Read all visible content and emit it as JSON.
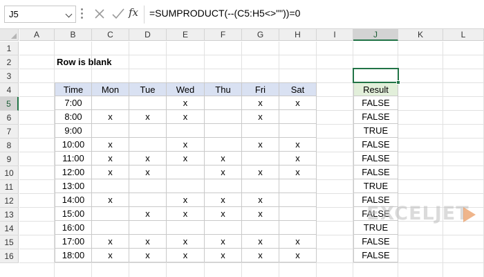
{
  "formula_bar": {
    "name_box": "J5",
    "fx_label": "fx",
    "formula": "=SUMPRODUCT(--(C5:H5<>\"\"))=0"
  },
  "columns": [
    "A",
    "B",
    "C",
    "D",
    "E",
    "F",
    "G",
    "H",
    "I",
    "J",
    "K",
    "L"
  ],
  "rows": [
    "1",
    "2",
    "3",
    "4",
    "5",
    "6",
    "7",
    "8",
    "9",
    "10",
    "11",
    "12",
    "13",
    "14",
    "15",
    "16"
  ],
  "sheet": {
    "title": "Row is blank",
    "headers": [
      "Time",
      "Mon",
      "Tue",
      "Wed",
      "Thu",
      "Fri",
      "Sat"
    ],
    "result_header": "Result",
    "data": [
      [
        "7:00",
        "",
        "",
        "x",
        "",
        "x",
        "x"
      ],
      [
        "8:00",
        "x",
        "x",
        "x",
        "",
        "x",
        ""
      ],
      [
        "9:00",
        "",
        "",
        "",
        "",
        "",
        ""
      ],
      [
        "10:00",
        "x",
        "",
        "x",
        "",
        "x",
        "x"
      ],
      [
        "11:00",
        "x",
        "x",
        "x",
        "x",
        "",
        "x"
      ],
      [
        "12:00",
        "x",
        "x",
        "",
        "x",
        "x",
        "x"
      ],
      [
        "13:00",
        "",
        "",
        "",
        "",
        "",
        ""
      ],
      [
        "14:00",
        "x",
        "",
        "x",
        "x",
        "x",
        ""
      ],
      [
        "15:00",
        "",
        "x",
        "x",
        "x",
        "x",
        ""
      ],
      [
        "16:00",
        "",
        "",
        "",
        "",
        "",
        ""
      ],
      [
        "17:00",
        "x",
        "x",
        "x",
        "x",
        "x",
        "x"
      ],
      [
        "18:00",
        "x",
        "x",
        "x",
        "x",
        "x",
        "x"
      ]
    ],
    "results": [
      "FALSE",
      "FALSE",
      "TRUE",
      "FALSE",
      "FALSE",
      "FALSE",
      "TRUE",
      "FALSE",
      "FALSE",
      "TRUE",
      "FALSE",
      "FALSE"
    ]
  },
  "logo": {
    "text": "EXCELJET"
  }
}
